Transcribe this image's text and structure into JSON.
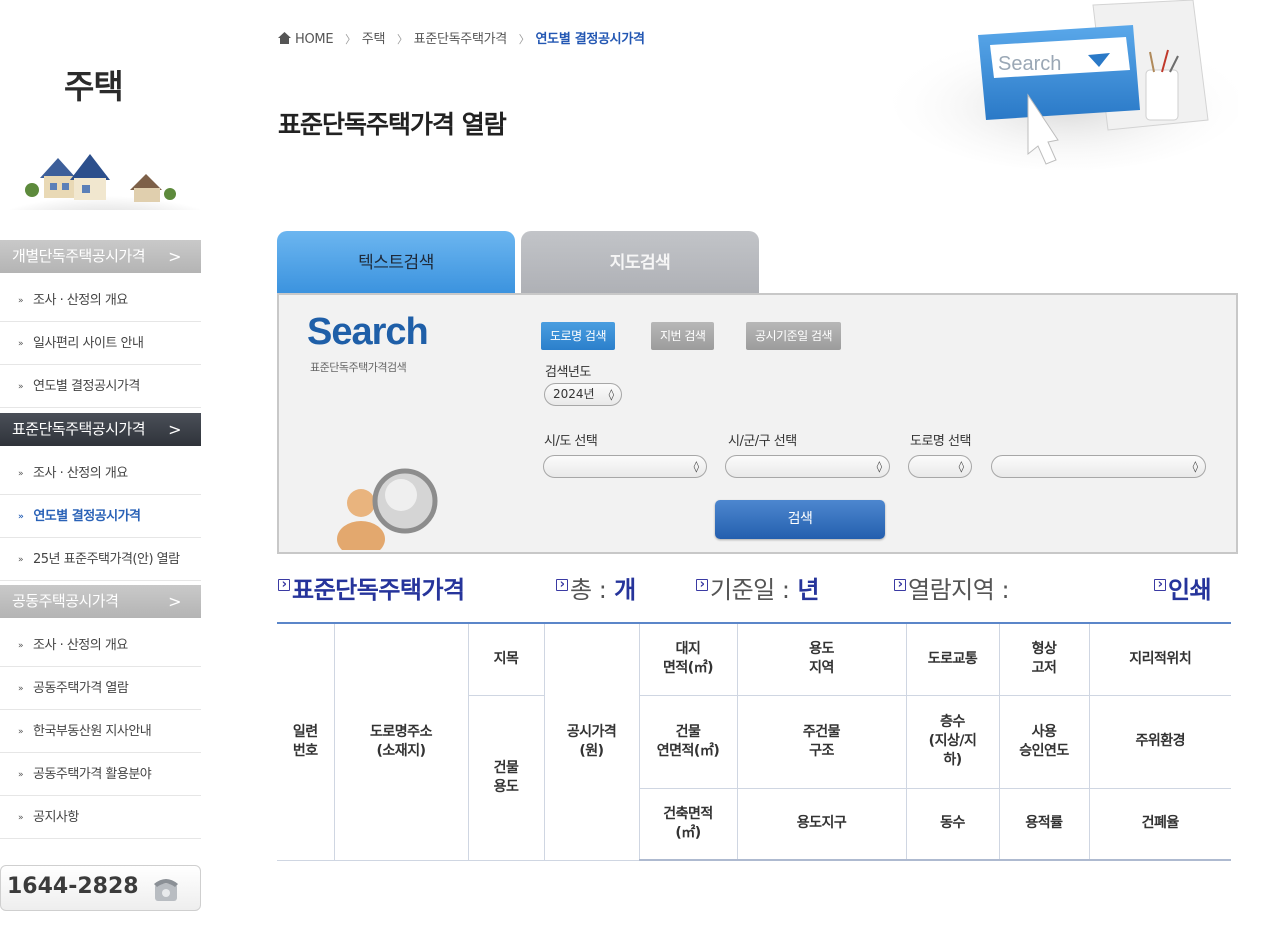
{
  "sidebar": {
    "title": "주택",
    "sections": [
      {
        "label": "개별단독주택공시가격",
        "arrow": ">",
        "items": [
          "조사 · 산정의 개요",
          "일사편리 사이트 안내",
          "연도별 결정공시가격"
        ]
      },
      {
        "label": "표준단독주택공시가격",
        "arrow": ">",
        "items": [
          "조사 · 산정의 개요",
          "연도별 결정공시가격",
          "25년 표준주택가격(안) 열람"
        ]
      },
      {
        "label": "공동주택공시가격",
        "arrow": ">",
        "items": [
          "조사 · 산정의 개요",
          "공동주택가격 열람",
          "한국부동산원 지사안내",
          "공동주택가격 활용분야",
          "공지사항"
        ]
      }
    ],
    "phone": "1644-2828"
  },
  "breadcrumb": {
    "home": "HOME",
    "items": [
      "주택",
      "표준단독주택가격"
    ],
    "current": "연도별 결정공시가격"
  },
  "page_title": "표준단독주택가격 열람",
  "header_illus_text": "Search",
  "tabs": {
    "text_search": "텍스트검색",
    "map_search": "지도검색"
  },
  "search": {
    "logo": "Search",
    "logo_sub": "표준단독주택가격검색",
    "types": [
      "도로명 검색",
      "지번 검색",
      "공시기준일 검색"
    ],
    "year_label": "검색년도",
    "year_value": "2024년",
    "sido_label": "시/도 선택",
    "sigungu_label": "시/군/구 선택",
    "road_label": "도로명 선택",
    "button": "검색"
  },
  "summary": {
    "title": "표준단독주택가격",
    "total_label": "총 :",
    "total_unit": "개",
    "base_label": "기준일 :",
    "base_unit": "년",
    "region_label": "열람지역 :",
    "print": "인쇄"
  },
  "table": {
    "serial": "일련\n번호",
    "address": "도로명주소\n(소재지)",
    "jimok": "지목",
    "bldg_use": "건물\n용도",
    "price": "공시가격\n(원)",
    "land_area": "대지\n면적(㎡)",
    "bldg_area": "건물\n연면적(㎡)",
    "build_area": "건축면적\n(㎡)",
    "zone": "용도\n지역",
    "structure": "주건물\n구조",
    "zone_district": "용도지구",
    "road": "도로교통",
    "floors": "층수\n(지상/지\n하)",
    "dong": "동수",
    "shape": "형상\n고저",
    "approval": "사용\n승인연도",
    "far": "용적률",
    "location": "지리적위치",
    "environment": "주위환경",
    "bcr": "건폐율"
  }
}
